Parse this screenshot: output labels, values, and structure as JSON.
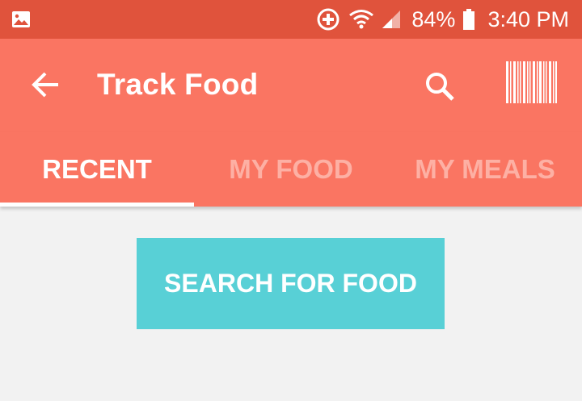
{
  "status_bar": {
    "left_icon": "image-icon",
    "icons": [
      "health-plus-icon",
      "wifi-icon",
      "signal-icon",
      "battery-icon"
    ],
    "battery": "84%",
    "time": "3:40 PM",
    "color": "#e0533c"
  },
  "toolbar": {
    "title": "Track Food",
    "back_icon": "arrow-left-icon",
    "search_icon": "search-icon",
    "barcode_icon": "barcode-icon",
    "color": "#fa7562"
  },
  "tabs": [
    {
      "label": "RECENT",
      "active": true
    },
    {
      "label": "MY FOOD",
      "active": false
    },
    {
      "label": "MY MEALS",
      "active": false
    }
  ],
  "main": {
    "search_button_label": "SEARCH FOR FOOD",
    "accent": "#58d0d6"
  }
}
